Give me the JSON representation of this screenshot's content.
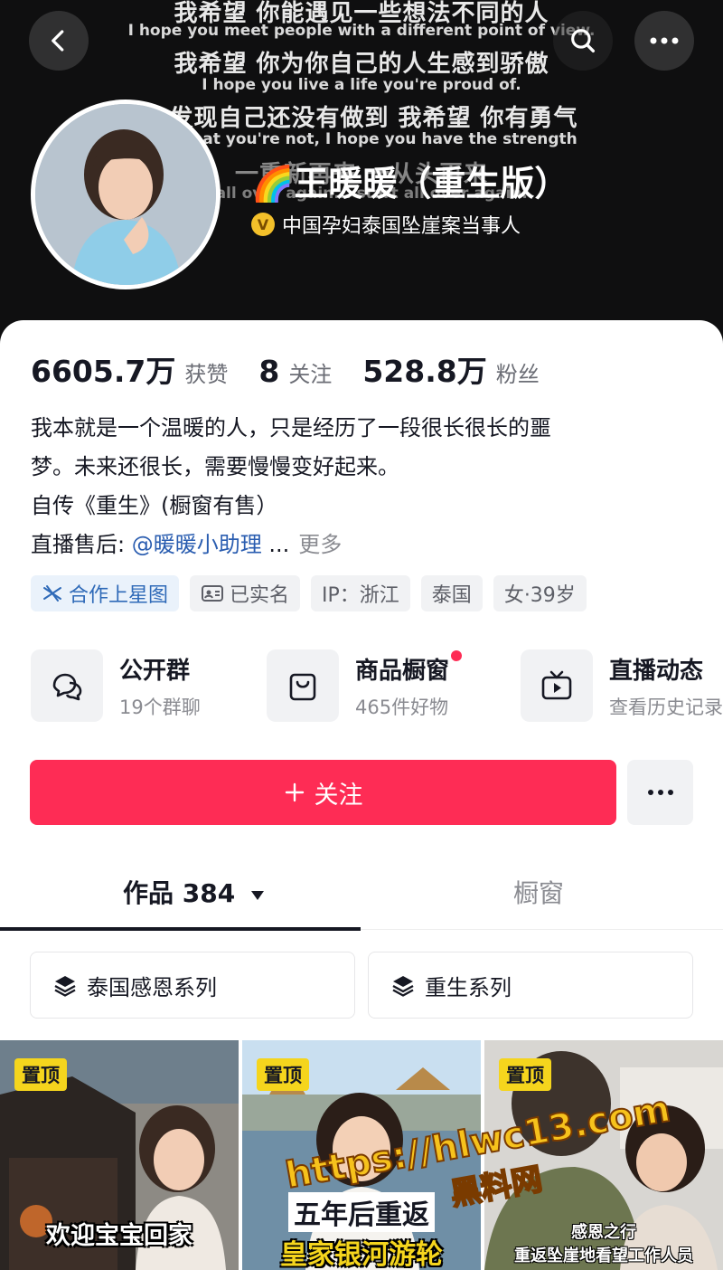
{
  "banner": {
    "lyrics": [
      {
        "lang": "cn",
        "text": "我希望 你能遇见一些想法不同的人"
      },
      {
        "lang": "en",
        "text": "I hope you meet people with a different point of view."
      },
      {
        "lang": "cn",
        "text": "我希望 你为你自己的人生感到骄傲"
      },
      {
        "lang": "en",
        "text": "I hope you live a life you're proud of."
      },
      {
        "lang": "cn",
        "text": "你发现自己还没有做到 我希望 你有勇气"
      },
      {
        "lang": "en",
        "text": "find that you're not, I hope you have the strength"
      },
      {
        "lang": "cn",
        "text": "一重新再来 一从头再来"
      },
      {
        "lang": "en",
        "text": "rt all over again... start all over again."
      }
    ]
  },
  "nav": {
    "back_icon": "chevron-left-icon",
    "search_icon": "search-icon",
    "more_icon": "more-horizontal-icon"
  },
  "profile": {
    "name": "🌈王暖暖（重生版）",
    "verify_badge": "V",
    "verify_text": "中国孕妇泰国坠崖案当事人"
  },
  "stats": [
    {
      "value": "6605.7万",
      "label": "获赞"
    },
    {
      "value": "8",
      "label": "关注"
    },
    {
      "value": "528.8万",
      "label": "粉丝"
    }
  ],
  "bio": {
    "line1": "我本就是一个温暖的人，只是经历了一段很长很长的噩",
    "line2": "梦。未来还很长，需要慢慢变好起来。",
    "line3": "自传《重生》(橱窗有售）",
    "line4_prefix": "直播售后: ",
    "line4_link": "@暖暖小助理",
    "line4_ellipsis": " ...",
    "more": "更多"
  },
  "tags": [
    {
      "text": "合作上星图",
      "icon": "star-map-icon",
      "accent": "#2f6ab8"
    },
    {
      "text": "已实名",
      "icon": "id-card-icon"
    },
    {
      "text": "IP：浙江"
    },
    {
      "text": "泰国"
    },
    {
      "text": "女·39岁"
    }
  ],
  "entries": [
    {
      "title": "公开群",
      "sub": "19个群聊",
      "icon": "chat-bubbles-icon"
    },
    {
      "title": "商品橱窗",
      "sub": "465件好物",
      "icon": "shopping-bag-icon",
      "dot": true
    },
    {
      "title": "直播动态",
      "sub": "查看历史记录",
      "icon": "tv-live-icon"
    }
  ],
  "actions": {
    "follow": "关注",
    "follow_color": "#fe2c55"
  },
  "tabs": {
    "works": "作品 384",
    "window": "橱窗"
  },
  "collections": [
    {
      "text": "泰国感恩系列",
      "icon": "layers-icon"
    },
    {
      "text": "重生系列",
      "icon": "layers-icon"
    }
  ],
  "videos": [
    {
      "pin": "置顶",
      "caption": "欢迎宝宝回家"
    },
    {
      "pin": "置顶",
      "caption_line1": "五年后重返",
      "caption_line2": "皇家银河游轮"
    },
    {
      "pin": "置顶",
      "caption_line1": "感恩之行",
      "caption_line2": "重返坠崖地看望工作人员"
    }
  ],
  "watermark": {
    "url": "https://hlwc13.com",
    "name": "黑料网"
  }
}
